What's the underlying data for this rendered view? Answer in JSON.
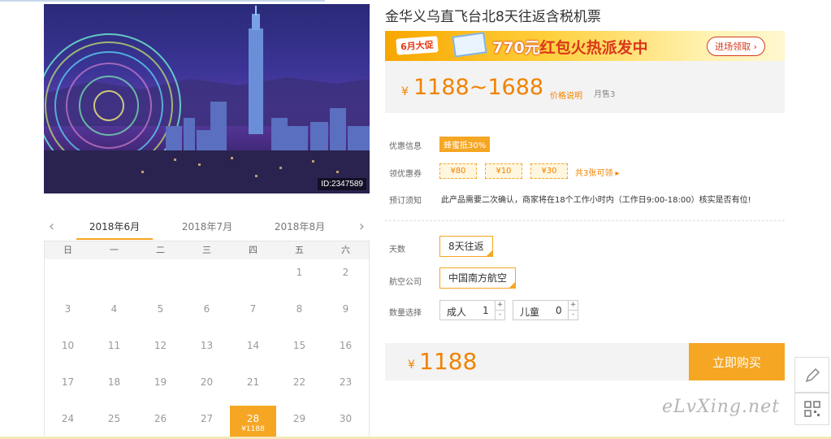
{
  "product": {
    "title": "金华义乌直飞台北8天往返含税机票",
    "image_id": "ID:2347589"
  },
  "banner": {
    "tag": "6月大促",
    "amount": "770元",
    "text": "红包火热派发中",
    "button": "进场领取 ›"
  },
  "price": {
    "currency": "¥",
    "range": "1188~1688",
    "explain": "价格说明",
    "sold": "月售3"
  },
  "info": {
    "promo_label": "优惠信息",
    "promo_tag": "蜂蜜抵30%",
    "coupon_label": "领优惠券",
    "coupons": [
      "¥80",
      "¥10",
      "¥30"
    ],
    "coupon_more": "共3张可领 ▸",
    "notice_label": "预订须知",
    "notice": "此产品需要二次确认，商家将在18个工作小时内（工作日9:00-18:00）核实是否有位!"
  },
  "options": {
    "days_label": "天数",
    "days_value": "8天往返",
    "airline_label": "航空公司",
    "airline_value": "中国南方航空",
    "qty_label": "数量选择",
    "adult_label": "成人",
    "adult_value": "1",
    "child_label": "儿童",
    "child_value": "0"
  },
  "total": {
    "currency": "¥",
    "amount": "1188",
    "buy_label": "立即购买"
  },
  "calendar": {
    "months": [
      "2018年6月",
      "2018年7月",
      "2018年8月"
    ],
    "weekdays": [
      "日",
      "一",
      "二",
      "三",
      "四",
      "五",
      "六"
    ],
    "rows": [
      [
        "",
        "",
        "",
        "",
        "",
        "1",
        "2"
      ],
      [
        "3",
        "4",
        "5",
        "6",
        "7",
        "8",
        "9"
      ],
      [
        "10",
        "11",
        "12",
        "13",
        "14",
        "15",
        "16"
      ],
      [
        "17",
        "18",
        "19",
        "20",
        "21",
        "22",
        "23"
      ],
      [
        "24",
        "25",
        "26",
        "27",
        "28",
        "29",
        "30"
      ]
    ],
    "selected_price": "¥1188"
  },
  "watermark": "eLvXing.net",
  "icons": {
    "prev": "chevron-left-icon",
    "next": "chevron-right-icon",
    "edit": "pencil-icon",
    "qr": "qr-code-icon"
  },
  "colors": {
    "accent": "#f5a623",
    "price": "#f08300"
  }
}
